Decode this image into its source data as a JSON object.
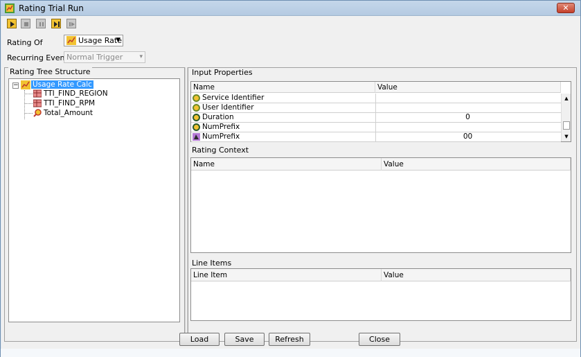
{
  "window": {
    "title": "Rating Trial Run",
    "close_label": "✕"
  },
  "toolbar": {
    "buttons": [
      {
        "name": "run-button",
        "icon": "play-icon",
        "active": true
      },
      {
        "name": "stop-button",
        "icon": "stop-icon",
        "active": false
      },
      {
        "name": "pause-button",
        "icon": "pause-icon",
        "active": false
      },
      {
        "name": "step-button",
        "icon": "step-icon",
        "active": true
      },
      {
        "name": "skip-button",
        "icon": "skip-icon",
        "active": false
      }
    ]
  },
  "rating_of": {
    "label": "Rating Of",
    "value": "Usage Rate"
  },
  "recurring_event": {
    "label": "Recurring Event",
    "value": "Normal Trigger"
  },
  "tree": {
    "title": "Rating Tree Structure",
    "root": "Usage Rate Calc",
    "children": [
      "TTI_FIND_REGION",
      "TTI_FIND_RPM",
      "Total_Amount"
    ]
  },
  "input_properties": {
    "title": "Input Properties",
    "columns": [
      "Name",
      "Value"
    ],
    "rows": [
      {
        "name": "Service Identifier",
        "value": "",
        "icon": "circle-icon"
      },
      {
        "name": "User Identifier",
        "value": "",
        "icon": "circle-icon"
      },
      {
        "name": "Duration",
        "value": "0",
        "icon": "number-icon"
      },
      {
        "name": "NumPrefix",
        "value": "",
        "icon": "number-icon"
      },
      {
        "name": "NumPrefix",
        "value": "00",
        "icon": "string-icon"
      }
    ]
  },
  "rating_context": {
    "title": "Rating Context",
    "columns": [
      "Name",
      "Value"
    ]
  },
  "line_items": {
    "title": "Line Items",
    "columns": [
      "Line Item",
      "Value"
    ]
  },
  "buttons": {
    "load": "Load",
    "save": "Save",
    "refresh": "Refresh",
    "close": "Close"
  },
  "colors": {
    "selection": "#3399ff",
    "titlebar": "#b4cae2",
    "close": "#c4402a"
  }
}
